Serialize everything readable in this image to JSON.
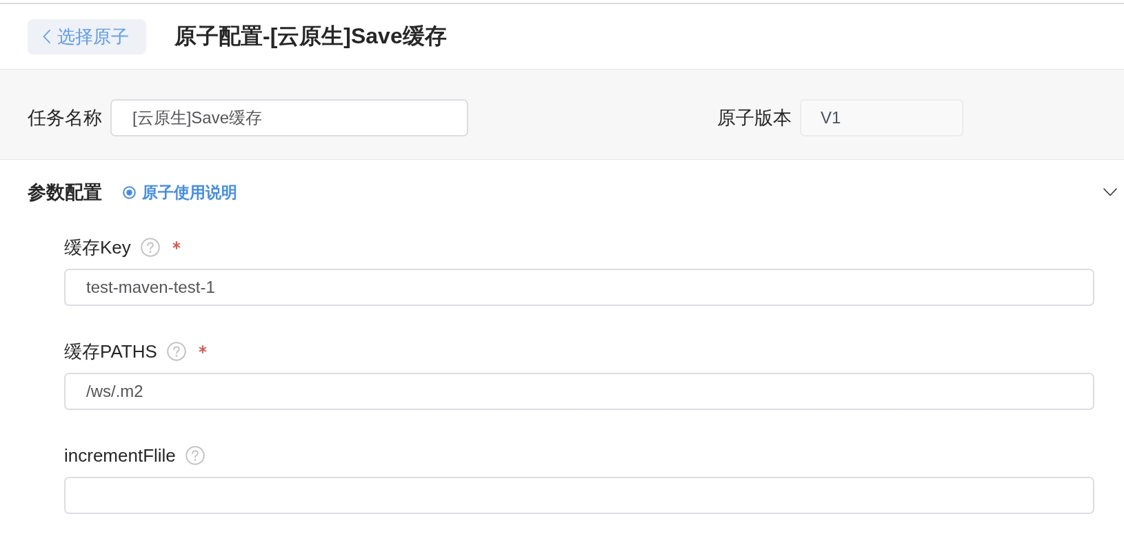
{
  "header": {
    "back_button": {
      "label": "选择原子"
    },
    "title": "原子配置-[云原生]Save缓存"
  },
  "basic": {
    "task_name": {
      "label": "任务名称",
      "value": "[云原生]Save缓存",
      "disabled": false
    },
    "version": {
      "label": "原子版本",
      "value": "V1",
      "disabled": true
    }
  },
  "section": {
    "title": "参数配置",
    "help_link": "原子使用说明",
    "expanded": true,
    "fields": [
      {
        "label": "缓存Key",
        "required": true,
        "value": "test-maven-test-1"
      },
      {
        "label": "缓存PATHS",
        "required": true,
        "value": "/ws/.m2"
      },
      {
        "label": "incrementFlile",
        "required": false
      }
    ]
  }
}
